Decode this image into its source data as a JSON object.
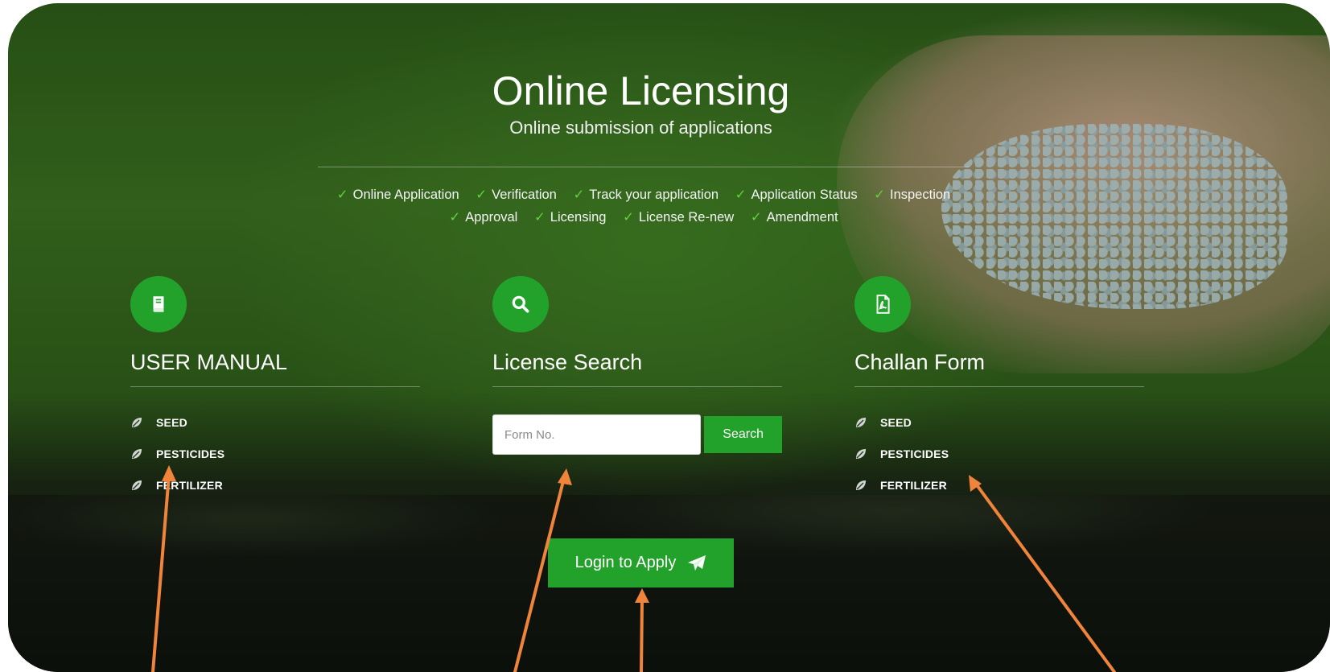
{
  "header": {
    "title": "Online Licensing",
    "subtitle": "Online submission of applications"
  },
  "features": {
    "row1": [
      "Online Application",
      "Verification",
      "Track your application",
      "Application Status",
      "Inspection"
    ],
    "row2": [
      "Approval",
      "Licensing",
      "License Re-new",
      "Amendment"
    ]
  },
  "user_manual": {
    "title": "USER MANUAL",
    "icon": "book-icon",
    "items": [
      "SEED",
      "PESTICIDES",
      "FERTILIZER"
    ]
  },
  "license_search": {
    "title": "License Search",
    "icon": "search-icon",
    "placeholder": "Form No.",
    "button_label": "Search"
  },
  "challan_form": {
    "title": "Challan Form",
    "icon": "pdf-file-icon",
    "items": [
      "SEED",
      "PESTICIDES",
      "FERTILIZER"
    ]
  },
  "login": {
    "label": "Login to Apply",
    "icon": "paper-plane-icon"
  },
  "colors": {
    "accent_green": "#23a22b",
    "check_green": "#5fd13a",
    "annotation_arrow": "#f0843a"
  }
}
